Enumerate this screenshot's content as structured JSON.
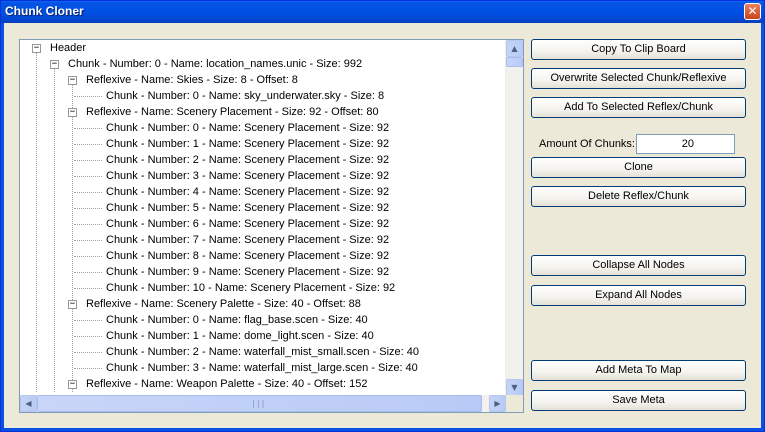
{
  "window": {
    "title": "Chunk Cloner",
    "close_glyph": "✕"
  },
  "tree": {
    "expander_minus": "−",
    "rows": [
      {
        "text": "Header",
        "level": 0,
        "expander": true
      },
      {
        "text": "Chunk - Number: 0 - Name: location_names.unic - Size: 992",
        "level": 1,
        "expander": true
      },
      {
        "text": "Reflexive - Name: Skies - Size: 8 - Offset: 8",
        "level": 2,
        "expander": true
      },
      {
        "text": "Chunk - Number: 0 - Name: sky_underwater.sky  - Size: 8",
        "level": 3,
        "expander": false
      },
      {
        "text": "Reflexive - Name: Scenery Placement - Size: 92 - Offset: 80",
        "level": 2,
        "expander": true
      },
      {
        "text": "Chunk - Number: 0 - Name: Scenery Placement - Size: 92",
        "level": 3,
        "expander": false
      },
      {
        "text": "Chunk - Number: 1 - Name: Scenery Placement - Size: 92",
        "level": 3,
        "expander": false
      },
      {
        "text": "Chunk - Number: 2 - Name: Scenery Placement - Size: 92",
        "level": 3,
        "expander": false
      },
      {
        "text": "Chunk - Number: 3 - Name: Scenery Placement - Size: 92",
        "level": 3,
        "expander": false
      },
      {
        "text": "Chunk - Number: 4 - Name: Scenery Placement - Size: 92",
        "level": 3,
        "expander": false
      },
      {
        "text": "Chunk - Number: 5 - Name: Scenery Placement - Size: 92",
        "level": 3,
        "expander": false
      },
      {
        "text": "Chunk - Number: 6 - Name: Scenery Placement - Size: 92",
        "level": 3,
        "expander": false
      },
      {
        "text": "Chunk - Number: 7 - Name: Scenery Placement - Size: 92",
        "level": 3,
        "expander": false
      },
      {
        "text": "Chunk - Number: 8 - Name: Scenery Placement - Size: 92",
        "level": 3,
        "expander": false
      },
      {
        "text": "Chunk - Number: 9 - Name: Scenery Placement - Size: 92",
        "level": 3,
        "expander": false
      },
      {
        "text": "Chunk - Number: 10 - Name: Scenery Placement - Size: 92",
        "level": 3,
        "expander": false
      },
      {
        "text": "Reflexive - Name: Scenery Palette - Size: 40 - Offset: 88",
        "level": 2,
        "expander": true
      },
      {
        "text": "Chunk - Number: 0 - Name: flag_base.scen - Size: 40",
        "level": 3,
        "expander": false
      },
      {
        "text": "Chunk - Number: 1 - Name: dome_light.scen - Size: 40",
        "level": 3,
        "expander": false
      },
      {
        "text": "Chunk - Number: 2 - Name: waterfall_mist_small.scen - Size: 40",
        "level": 3,
        "expander": false
      },
      {
        "text": "Chunk - Number: 3 - Name: waterfall_mist_large.scen - Size: 40",
        "level": 3,
        "expander": false
      },
      {
        "text": "Reflexive - Name: Weapon Palette - Size: 40 - Offset: 152",
        "level": 2,
        "expander": true
      }
    ]
  },
  "scrollbars": {
    "up": "▲",
    "down": "▼",
    "left": "◀",
    "right": "▶",
    "grip": "|||"
  },
  "actions": {
    "copy_to_clipboard": "Copy To Clip Board",
    "overwrite_selected": "Overwrite Selected Chunk/Reflexive",
    "add_to_selected": "Add To Selected Reflex/Chunk",
    "amount_label": "Amount Of Chunks:",
    "amount_value": "20",
    "clone": "Clone",
    "delete": "Delete Reflex/Chunk",
    "collapse_all": "Collapse All Nodes",
    "expand_all": "Expand All Nodes",
    "add_meta": "Add Meta To Map",
    "save_meta": "Save Meta"
  },
  "colors": {
    "title_bar": "#0054e3",
    "window_bg": "#ece9d8",
    "button_border": "#003c74",
    "scrollbar": "#c1d3fb"
  }
}
